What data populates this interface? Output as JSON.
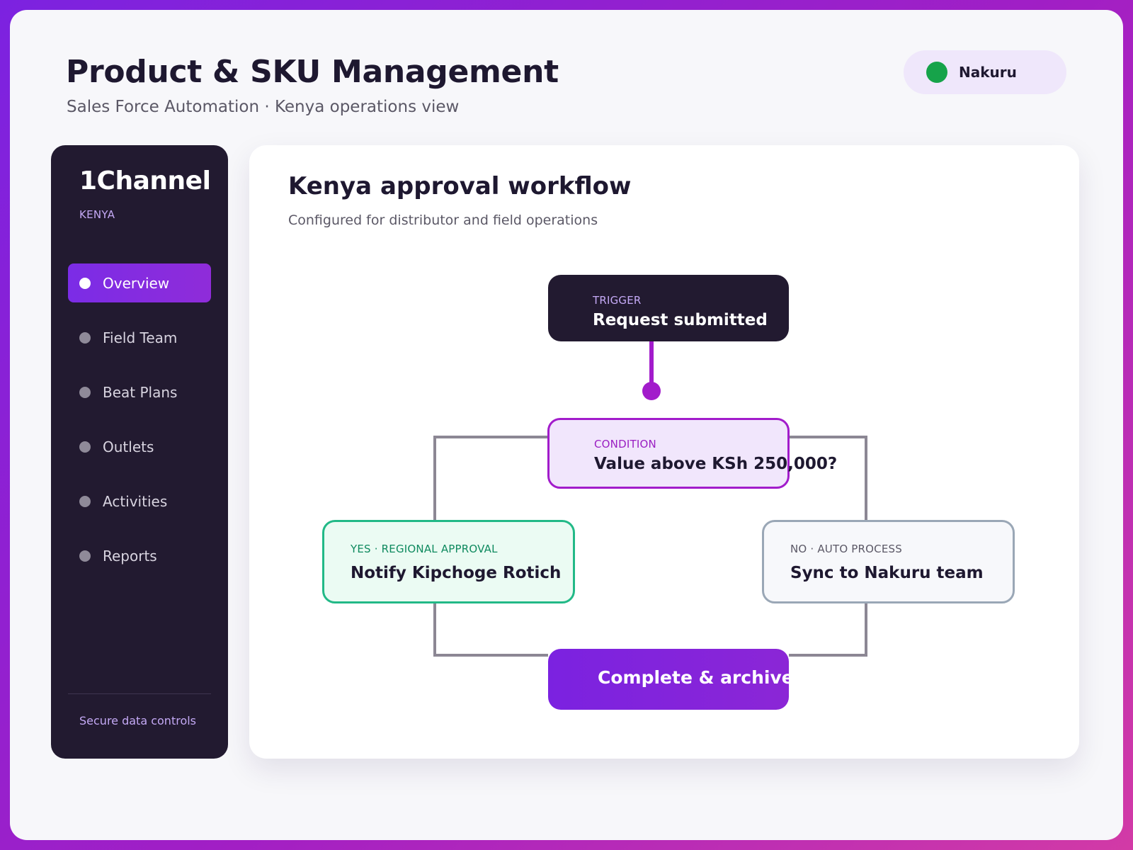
{
  "header": {
    "title": "Product & SKU Management",
    "subtitle": "Sales Force Automation · Kenya operations view",
    "location": "Nakuru"
  },
  "sidebar": {
    "brand": "1Channel",
    "region": "KENYA",
    "items": [
      {
        "label": "Overview",
        "active": true
      },
      {
        "label": "Field Team"
      },
      {
        "label": "Beat Plans"
      },
      {
        "label": "Outlets"
      },
      {
        "label": "Activities"
      },
      {
        "label": "Reports"
      }
    ],
    "footer": "Secure data controls"
  },
  "workflow": {
    "title": "Kenya approval workflow",
    "subtitle": "Configured for distributor and field operations",
    "trigger": {
      "tag": "TRIGGER",
      "text": "Request submitted"
    },
    "condition": {
      "tag": "CONDITION",
      "text": "Value above KSh 250,000?"
    },
    "yes": {
      "tag": "YES · REGIONAL APPROVAL",
      "text": "Notify Kipchoge Rotich"
    },
    "no": {
      "tag": "NO · AUTO PROCESS",
      "text": "Sync to Nakuru team"
    },
    "complete": {
      "text": "Complete & archive"
    }
  },
  "colors": {
    "accent": "#7b2ce6",
    "sidebar_bg": "#221a30",
    "status_online": "#16a34a",
    "yes_border": "#22b987",
    "condition_border": "#a21ccb"
  }
}
